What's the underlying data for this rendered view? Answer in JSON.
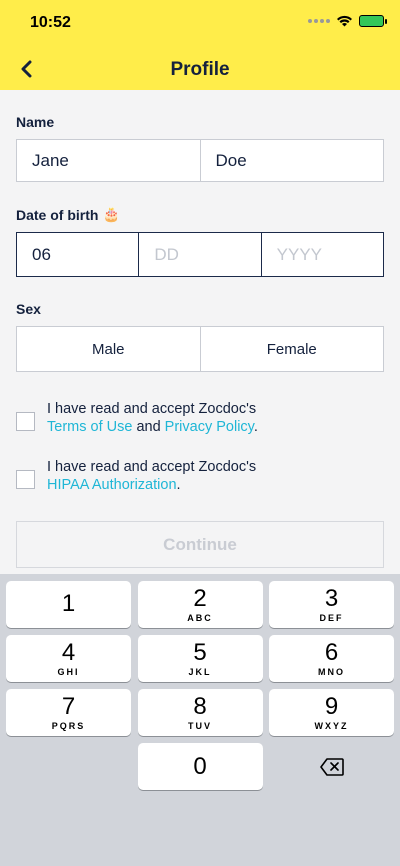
{
  "status": {
    "time": "10:52"
  },
  "nav": {
    "title": "Profile"
  },
  "name": {
    "label": "Name",
    "first": "Jane",
    "last": "Doe"
  },
  "dob": {
    "label": "Date of birth",
    "emoji": "🎂",
    "month": "06",
    "day_placeholder": "DD",
    "year_placeholder": "YYYY"
  },
  "sex": {
    "label": "Sex",
    "male": "Male",
    "female": "Female"
  },
  "terms": {
    "line1": "I have read and accept Zocdoc's",
    "terms_link": "Terms of Use",
    "and": " and ",
    "privacy_link": "Privacy Policy",
    "end": "."
  },
  "hipaa": {
    "line1": "I have read and accept Zocdoc's",
    "link": "HIPAA Authorization",
    "end": "."
  },
  "continue_label": "Continue",
  "keypad": {
    "keys": [
      {
        "num": "1",
        "letters": ""
      },
      {
        "num": "2",
        "letters": "ABC"
      },
      {
        "num": "3",
        "letters": "DEF"
      },
      {
        "num": "4",
        "letters": "GHI"
      },
      {
        "num": "5",
        "letters": "JKL"
      },
      {
        "num": "6",
        "letters": "MNO"
      },
      {
        "num": "7",
        "letters": "PQRS"
      },
      {
        "num": "8",
        "letters": "TUV"
      },
      {
        "num": "9",
        "letters": "WXYZ"
      },
      {
        "num": "0",
        "letters": ""
      }
    ]
  },
  "colors": {
    "header": "#ffed4a",
    "link": "#1fb6d6",
    "text": "#14213d"
  }
}
